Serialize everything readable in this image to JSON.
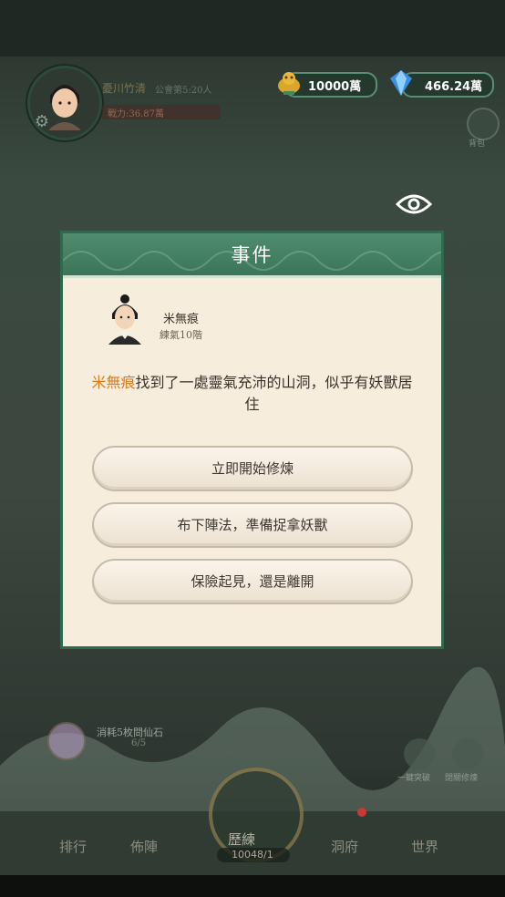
{
  "player": {
    "name": "憂川竹清",
    "sect": "公會第5:20人",
    "power": "戰力:36.87萬"
  },
  "resources": {
    "gold": "10000萬",
    "gems": "466.24萬"
  },
  "bag_label": "背包",
  "dialog": {
    "title": "事件",
    "npc_name": "米無痕",
    "npc_realm": "練氣10階",
    "event_highlight": "米無痕",
    "event_text": "找到了一處靈氣充沛的山洞，似乎有妖獸居住",
    "choices": [
      "立即開始修煉",
      "布下陣法，準備捉拿妖獸",
      "保險起見，還是離開"
    ]
  },
  "background": {
    "stone_label": "消耗5枚問仙石",
    "stone_count": "6/5",
    "side_left": "一鍵突破",
    "side_right": "閉關修煉",
    "nav": [
      "排行",
      "佈陣",
      "歷練",
      "洞府",
      "世界"
    ],
    "center_count": "10048/1"
  },
  "colors": {
    "accent_green": "#3b7559",
    "highlight_orange": "#d77c22",
    "dialog_bg": "#f7eddc"
  }
}
